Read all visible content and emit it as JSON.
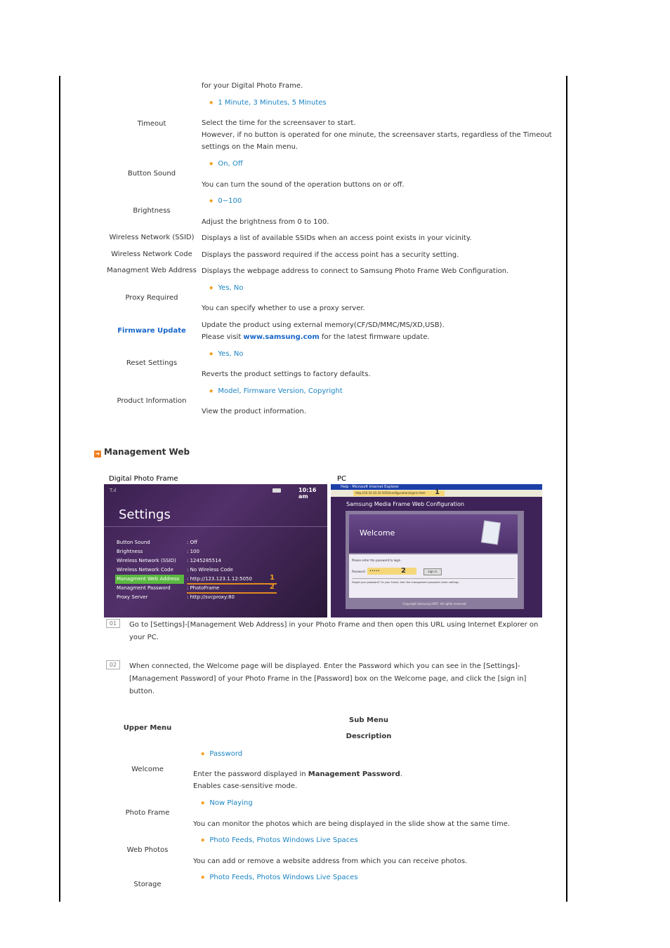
{
  "intro_text": "for your Digital Photo Frame.",
  "settings_rows": [
    {
      "label": "Timeout",
      "options": "1 Minute, 3 Minutes, 5 Minutes",
      "desc1": "Select the time for the screensaver to start.",
      "desc2": "However, if no button is operated for one minute, the screensaver starts, regardless of the Timeout",
      "desc3": "settings on the Main menu."
    },
    {
      "label": "Button Sound",
      "options": "On, Off",
      "desc1": "You can turn the sound of the operation buttons on or off."
    },
    {
      "label": "Brightness",
      "options": "0~100",
      "desc1": "Adjust the brightness from 0 to 100."
    },
    {
      "label": "Wireless Network (SSID)",
      "desc1": "Displays a list of available SSIDs when an access point exists in your vicinity."
    },
    {
      "label": "Wireless Network Code",
      "desc1": "Displays the password required if the access point has a security setting."
    },
    {
      "label": "Managment Web Address",
      "desc1": "Displays the webpage address to connect to Samsung Photo Frame Web Configuration."
    },
    {
      "label": "Proxy Required",
      "options": "Yes, No",
      "desc1": "You can specify whether to use a proxy server."
    },
    {
      "label": "Firmware Update",
      "desc1": "Update the product using external memory(CF/SD/MMC/MS/XD,USB).",
      "desc2_pre": "Please visit ",
      "desc2_link": "www.samsung.com",
      "desc2_post": " for the latest firmware update."
    },
    {
      "label": "Reset Settings",
      "options": "Yes, No",
      "desc1": "Reverts the product settings to factory defaults."
    },
    {
      "label": "Product Information",
      "options": "Model, Firmware Version, Copyright",
      "desc1": "View the product information."
    }
  ],
  "section_title": "Management Web",
  "images": {
    "frame_label": "Digital Photo Frame",
    "pc_label": "PC",
    "frame": {
      "status_left": "T.ıl",
      "time": "10:16 am",
      "title": "Settings",
      "rows": [
        {
          "key": "Button Sound",
          "value": ": Off"
        },
        {
          "key": "Brightness",
          "value": ": 100"
        },
        {
          "key": "Wireless Network (SSID)",
          "value": ": 1245285514"
        },
        {
          "key": "Wireless Network Code",
          "value": ": No Wireless Code"
        },
        {
          "key": "Managment Web Address",
          "value": ": http://123.123.1.12:5050"
        },
        {
          "key": "Managment Password",
          "value": ": PhotoFrame"
        },
        {
          "key": "Proxy Server",
          "value": ": http://svcproxy:80"
        }
      ],
      "marker1": "1",
      "marker2": "2"
    },
    "pc": {
      "window_title": "Help - Microsoft Internet Explorer",
      "url": "http://10.10.10.10:5050/configuration/signin.html",
      "marker1": "1",
      "page_title": "Samsung Media Frame Web Configuration",
      "welcome": "Welcome",
      "prompt": "Please enter the password to login.",
      "password_label": "Password",
      "password_value": "•••••",
      "marker2": "2",
      "signin": "sign in",
      "forgot": "Forgot your password? On your frame, then the management password under settings.",
      "copyright": "Copyright Samsung 2007. All rights reserved."
    }
  },
  "steps": [
    {
      "num": "01",
      "text": "Go to [Settings]-[Management Web Address] in your Photo Frame and then open this URL using Internet Explorer on your PC."
    },
    {
      "num": "02",
      "text": "When connected, the Welcome page will be displayed. Enter the Password which you can see in the [Settings]-[Management Password] of your Photo Frame in the [Password] box on the Welcome page, and click the [sign in] button."
    }
  ],
  "table": {
    "upper_menu": "Upper Menu",
    "sub_menu": "Sub Menu",
    "description": "Description",
    "rows": [
      {
        "label": "Welcome",
        "options": "Password",
        "desc1_pre": "Enter the password displayed in ",
        "desc1_bold": "Management Password",
        "desc1_post": ".",
        "desc2": "Enables case-sensitive mode."
      },
      {
        "label": "Photo Frame",
        "options": "Now Playing",
        "desc1": "You can monitor the photos which are being displayed in the slide show at the same time."
      },
      {
        "label": "Web Photos",
        "options": "Photo Feeds, Photos Windows Live Spaces",
        "desc1": "You can add or remove a website address from which you can receive photos."
      },
      {
        "label": "Storage",
        "options": "Photo Feeds, Photos Windows Live Spaces"
      }
    ]
  }
}
